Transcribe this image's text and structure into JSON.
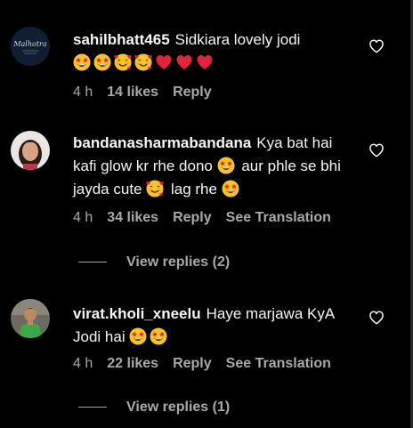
{
  "comments": [
    {
      "username": "sahilbhatt465",
      "text_parts": [
        "Sidkiara lovely jodi"
      ],
      "emojis_line1": [
        "star-struck",
        "star-struck",
        "smiling-hearts",
        "smiling-hearts",
        "red-heart",
        "red-heart",
        "red-heart"
      ],
      "time": "4 h",
      "likes": "14 likes",
      "reply": "Reply"
    },
    {
      "username": "bandanasharmabandana",
      "text_a": "Kya bat hai kafi glow kr rhe dono",
      "text_b": "aur phle se bhi jayda cute",
      "text_c": "lag rhe",
      "time": "4 h",
      "likes": "34 likes",
      "reply": "Reply",
      "translation": "See Translation",
      "view_replies": "View replies (2)"
    },
    {
      "username": "virat.kholi_xneelu",
      "text_a": "Haye marjawa KyA Jodi hai",
      "time": "4 h",
      "likes": "22 likes",
      "reply": "Reply",
      "translation": "See Translation",
      "view_replies": "View replies (1)"
    }
  ],
  "colors": {
    "background": "#000000",
    "primary_text": "#f5f5f5",
    "secondary_text": "#a8a8a8"
  },
  "icons": {
    "like": "heart-outline-icon"
  }
}
